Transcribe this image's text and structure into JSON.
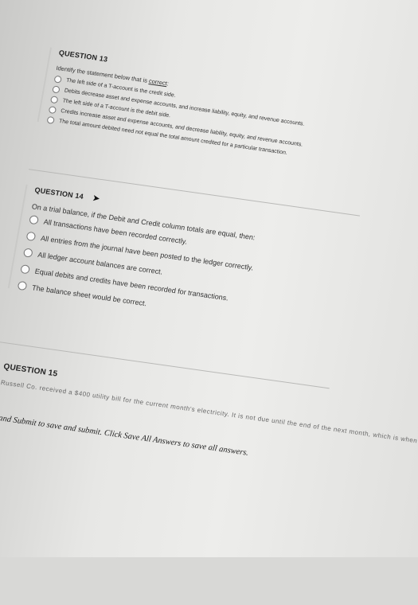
{
  "q13": {
    "header": "QUESTION 13",
    "prompt_before": "Identify the statement below that is ",
    "prompt_emph": "correct",
    "prompt_after": ":",
    "options": [
      "The left side of a T-account is the credit side.",
      "Debits decrease asset and expense accounts, and increase liability, equity, and revenue accounts.",
      "The left side of a T-account is the debit side.",
      "Credits increase asset and expense accounts, and decrease liability, equity, and revenue accounts.",
      "The total amount debited need not equal the total amount credited for a particular transaction."
    ]
  },
  "q14": {
    "header": "QUESTION 14",
    "prompt": "On a trial balance, if the Debit and Credit column totals are equal, then:",
    "options": [
      "All transactions have been recorded correctly.",
      "All entries from the journal have been posted to the ledger correctly.",
      "All ledger account balances are correct.",
      "Equal debits and credits have been recorded for transactions.",
      "The balance sheet would be correct."
    ]
  },
  "q15": {
    "header": "QUESTION 15",
    "partial_text": "Russell Co. received a $400 utility bill for the current month's electricity. It is not due until the end of the next month, which is when they will"
  },
  "footer": {
    "instruction": "Click Save and Submit to save and submit. Click Save All Answers to save all answers."
  }
}
